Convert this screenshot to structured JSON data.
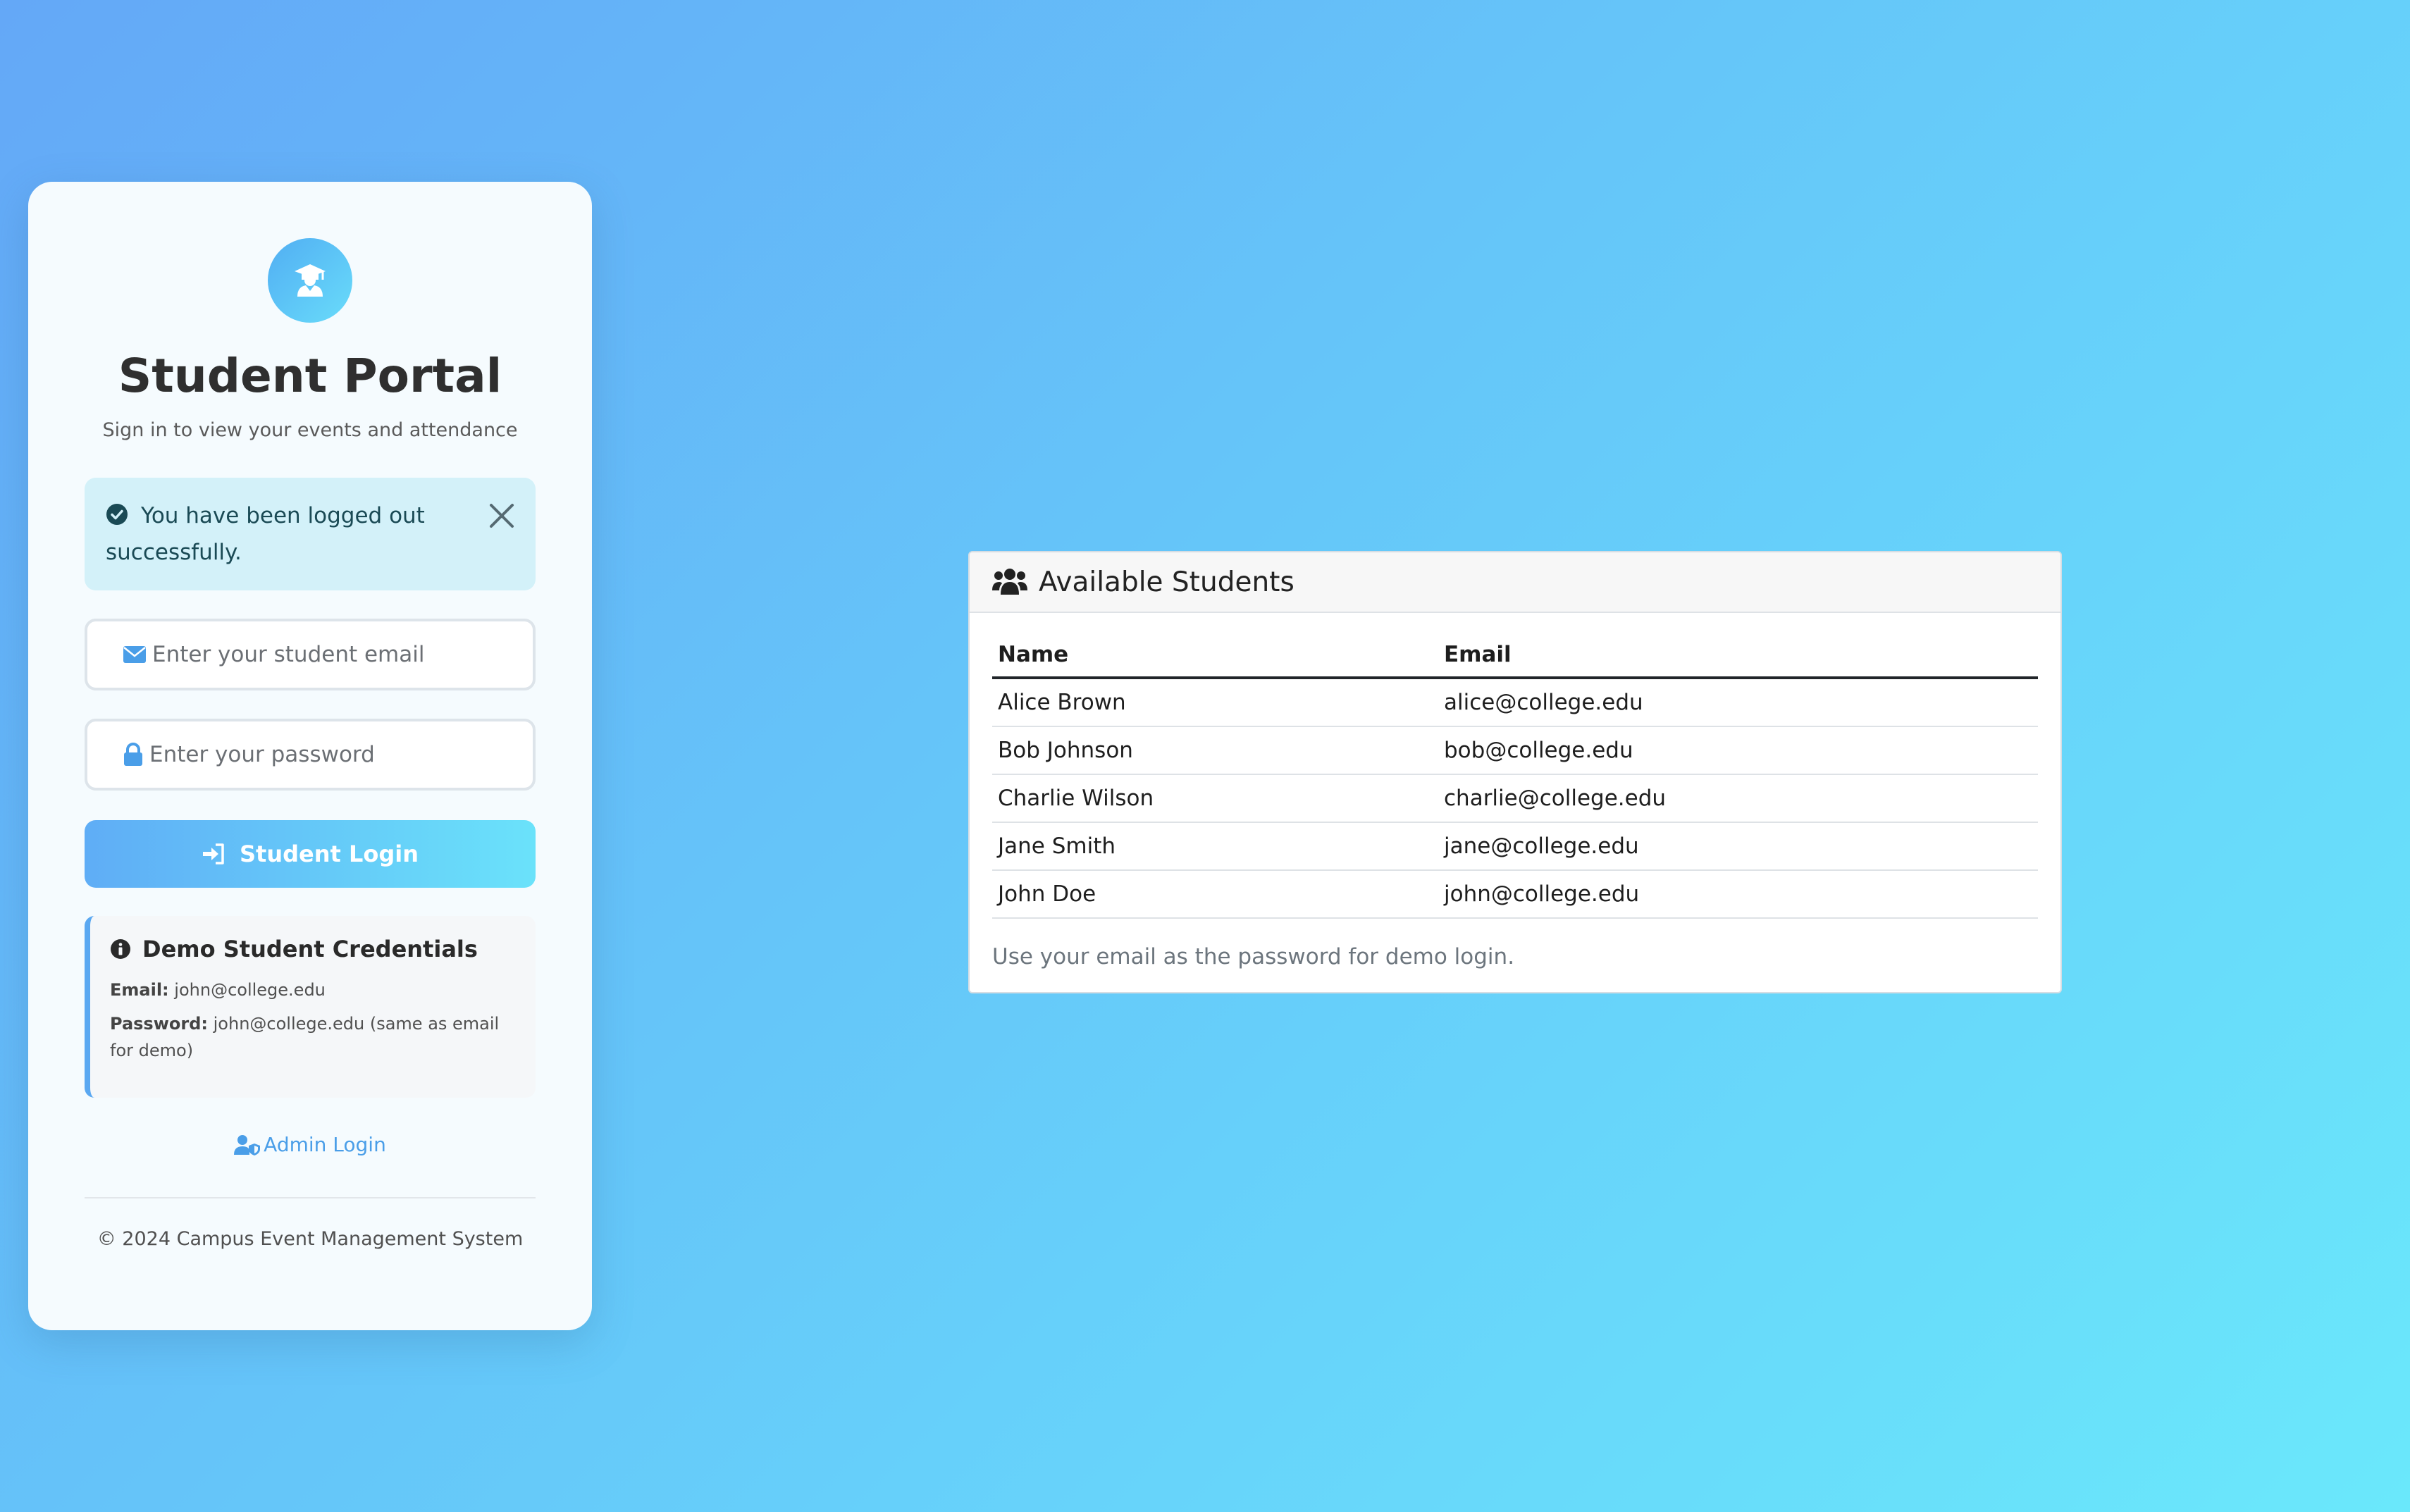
{
  "portal": {
    "logo_icon": "graduate-icon",
    "title": "Student Portal",
    "subtitle": "Sign in to view your events and attendance",
    "alert": {
      "message": "You have been logged out successfully.",
      "icon": "check-circle-icon",
      "close_icon": "close-icon"
    },
    "email_input": {
      "placeholder": "Enter your student email",
      "value": "",
      "icon": "envelope-icon"
    },
    "password_input": {
      "placeholder": "Enter your password",
      "value": "",
      "icon": "lock-icon"
    },
    "login_button": {
      "label": "Student Login",
      "icon": "sign-in-icon"
    },
    "demo": {
      "title": "Demo Student Credentials",
      "email_label": "Email:",
      "email_value": "john@college.edu",
      "password_label": "Password:",
      "password_value": "john@college.edu (same as email for demo)"
    },
    "admin_link": "Admin Login",
    "footer": "© 2024 Campus Event Management System"
  },
  "students": {
    "header": "Available Students",
    "columns": [
      "Name",
      "Email"
    ],
    "rows": [
      {
        "name": "Alice Brown",
        "email": "alice@college.edu"
      },
      {
        "name": "Bob Johnson",
        "email": "bob@college.edu"
      },
      {
        "name": "Charlie Wilson",
        "email": "charlie@college.edu"
      },
      {
        "name": "Jane Smith",
        "email": "jane@college.edu"
      },
      {
        "name": "John Doe",
        "email": "john@college.edu"
      }
    ],
    "note": "Use your email as the password for demo login."
  },
  "colors": {
    "accent": "#5fadf6",
    "accent_light": "#6ae2fa",
    "alert_bg": "#d3f1f9"
  }
}
